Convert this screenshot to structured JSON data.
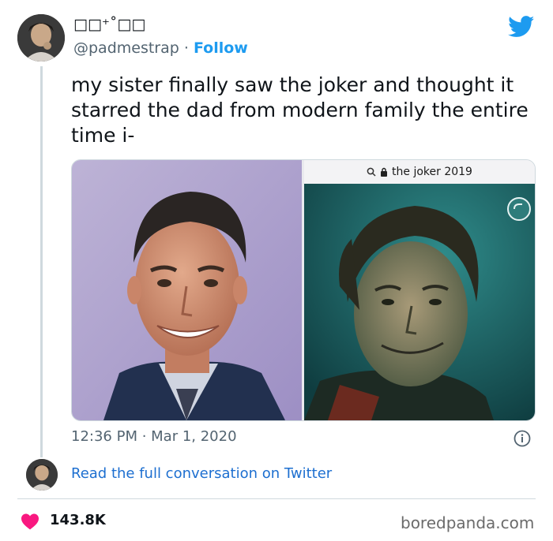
{
  "tweet": {
    "display_name": "□□⁺˚□□",
    "handle": "@padmestrap",
    "separator": "·",
    "follow_label": "Follow",
    "text": "my sister finally saw the joker and thought it starred the dad from modern family the entire time i-",
    "timestamp": "12:36 PM · Mar 1, 2020",
    "read_link_label": "Read the full conversation on Twitter",
    "like_count": "143.8K"
  },
  "media": {
    "right_panel": {
      "address_bar_text": "the joker 2019",
      "search_icon": "search-icon",
      "lock_icon": "lock-icon"
    }
  },
  "icons": {
    "brand": "twitter-bird-icon",
    "info": "info-icon",
    "like": "heart-icon"
  },
  "watermark": "boredpanda.com",
  "colors": {
    "twitter_blue": "#1d9bf0",
    "link_blue": "#1d6fd0",
    "heart_red": "#f91880",
    "muted_text": "#536471"
  }
}
